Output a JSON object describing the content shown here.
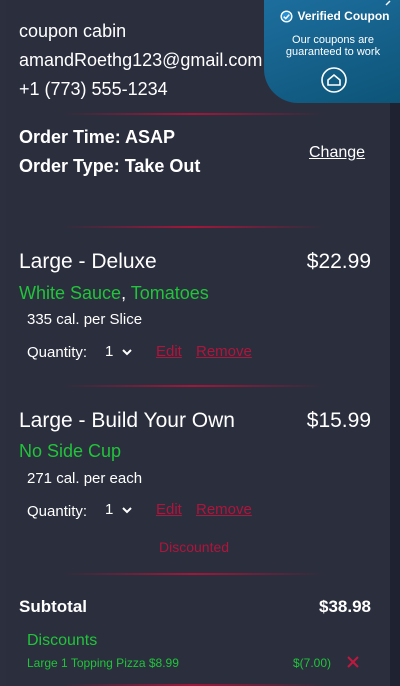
{
  "contact": {
    "name": "coupon cabin",
    "email": "amandRoethg123@gmail.com",
    "phone": "+1 (773) 555-1234"
  },
  "order": {
    "time_line": "Order Time: ASAP",
    "type_line": "Order Type: Take Out",
    "change_label": "Change"
  },
  "items": [
    {
      "name": "Large - Deluxe",
      "price": "$22.99",
      "topping_1": "White Sauce",
      "separator": ", ",
      "topping_2": "Tomatoes",
      "calories": "335 cal. per Slice",
      "quantity_label": "Quantity:",
      "quantity": "1",
      "edit_label": "Edit",
      "remove_label": "Remove"
    },
    {
      "name": "Large - Build Your Own",
      "price": "$15.99",
      "topping_1": "No Side Cup",
      "calories": "271 cal. per each",
      "quantity_label": "Quantity:",
      "quantity": "1",
      "edit_label": "Edit",
      "remove_label": "Remove",
      "note": "Discounted"
    }
  ],
  "summary": {
    "subtotal_label": "Subtotal",
    "subtotal_value": "$38.98",
    "discounts_heading": "Discounts",
    "discount_item": "Large 1 Topping Pizza $8.99",
    "discount_amount": "$(7.00)"
  },
  "badge": {
    "title": "Verified Coupon",
    "subtitle": "Our coupons are guaranteed to work"
  },
  "colors": {
    "background": "#2a2e3d",
    "accent_green": "#21c43a",
    "accent_red": "#b0153c",
    "badge_blue": "#1d6e9e"
  },
  "icons": [
    "check-badge-icon",
    "home-icon",
    "chevron-down-icon",
    "close-icon"
  ]
}
